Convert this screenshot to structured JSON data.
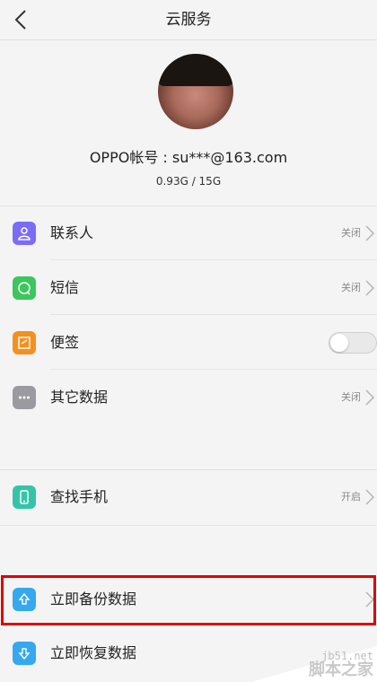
{
  "header": {
    "title": "云服务",
    "back_icon": "chevron-left-icon"
  },
  "account": {
    "label": "OPPO帐号 : su***@163.com",
    "storage": "0.93G / 15G"
  },
  "sync_items": [
    {
      "label": "联系人",
      "status": "关闭",
      "icon": "contacts-icon",
      "color": "#7b6cf6"
    },
    {
      "label": "短信",
      "status": "关闭",
      "icon": "message-icon",
      "color": "#3cc65e"
    },
    {
      "label": "便签",
      "status": "",
      "icon": "note-icon",
      "color": "#f5901f",
      "toggle": "off"
    },
    {
      "label": "其它数据",
      "status": "关闭",
      "icon": "more-icon",
      "color": "#9a9aa0"
    }
  ],
  "find_phone": {
    "label": "查找手机",
    "status": "开启",
    "icon": "phone-icon",
    "color": "#36c4a8"
  },
  "backup": {
    "label": "立即备份数据",
    "icon": "upload-icon",
    "color": "#35a8f0"
  },
  "restore": {
    "label": "立即恢复数据",
    "icon": "download-icon",
    "color": "#35a8f0"
  },
  "watermark": {
    "url": "jb51.net",
    "name": "脚本之家"
  }
}
